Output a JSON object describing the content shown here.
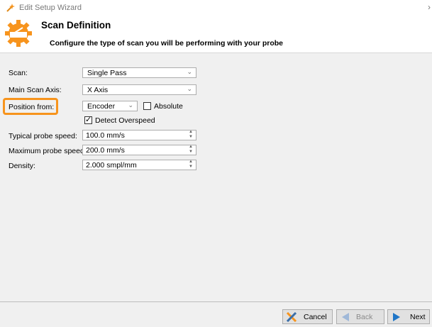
{
  "window": {
    "title": "Edit Setup Wizard",
    "close": "›"
  },
  "header": {
    "title": "Scan Definition",
    "subtitle": "Configure the type of scan you will be performing with your probe"
  },
  "form": {
    "scan": {
      "label": "Scan:",
      "value": "Single Pass"
    },
    "main_axis": {
      "label": "Main Scan Axis:",
      "value": "X Axis"
    },
    "position_from": {
      "label": "Position from:",
      "value": "Encoder",
      "absolute_label": "Absolute",
      "absolute_checked": false
    },
    "detect_overspeed": {
      "label": "Detect Overspeed",
      "checked": true
    },
    "typical_speed": {
      "label": "Typical probe speed:",
      "value": "100.0 mm/s"
    },
    "max_speed": {
      "label": "Maximum probe speed:",
      "value": "200.0 mm/s"
    },
    "density": {
      "label": "Density:",
      "value": "2.000 smpl/mm"
    }
  },
  "footer": {
    "cancel": "Cancel",
    "back": "Back",
    "next": "Next"
  },
  "colors": {
    "highlight": "#f7941d",
    "logo": "#f7941d"
  }
}
